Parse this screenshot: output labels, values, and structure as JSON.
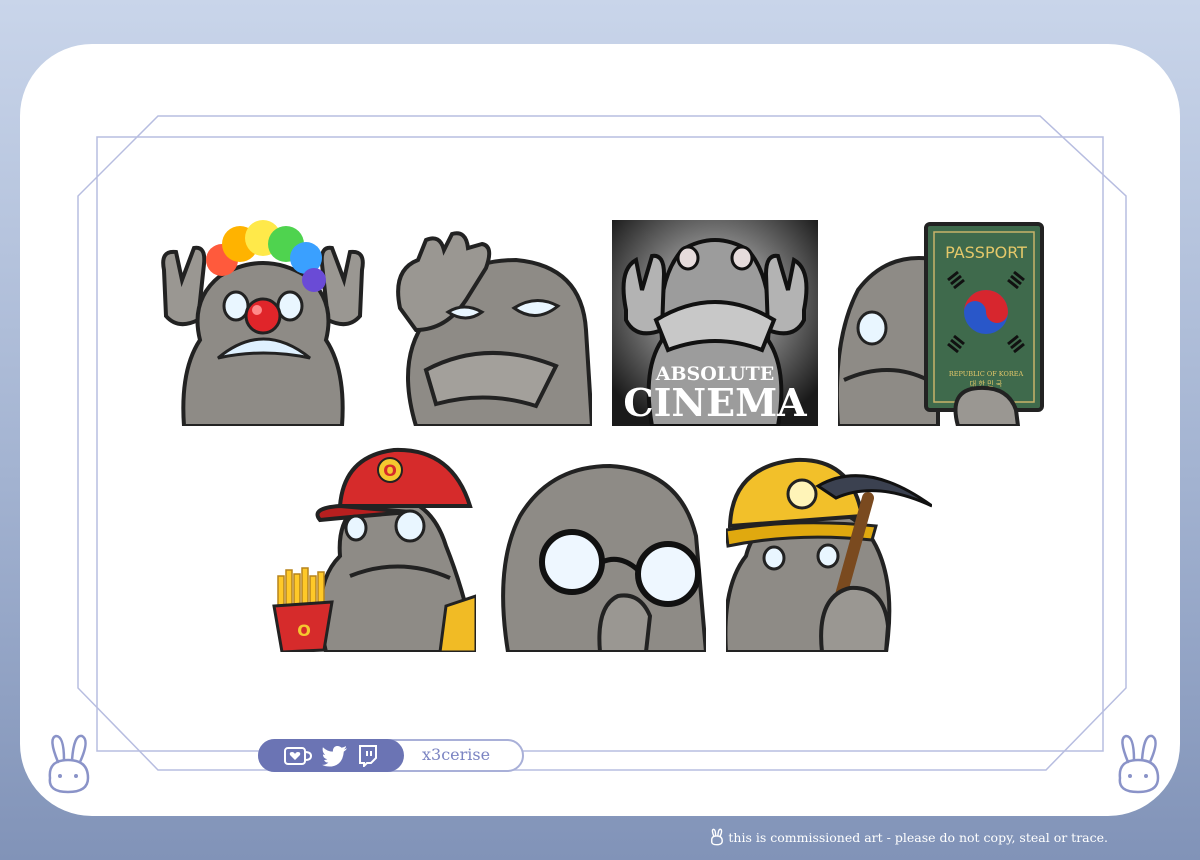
{
  "emotes": [
    {
      "name": "clown"
    },
    {
      "name": "salute"
    },
    {
      "name": "absolute-cinema",
      "caption_line1": "ABSOLUTE",
      "caption_line2": "CINEMA"
    },
    {
      "name": "passport",
      "book_title": "PASSPORT",
      "book_country": "REPUBLIC OF KOREA",
      "book_korean": "대 한 민 국",
      "cap_letter": ""
    },
    {
      "name": "fries",
      "cap_letter": "O",
      "box_letter": "O"
    },
    {
      "name": "glasses"
    },
    {
      "name": "miner"
    }
  ],
  "social": {
    "icons": [
      "ko-fi-icon",
      "twitter-icon",
      "twitch-icon"
    ],
    "handle": "x3cerise"
  },
  "footer": {
    "note": "this is commissioned art - please do not copy, steal or trace."
  },
  "colors": {
    "accent": "#6b74b4",
    "frame_line": "#a9b0d8",
    "rock": "#8e8b86",
    "rock_dark": "#5e5b57"
  }
}
